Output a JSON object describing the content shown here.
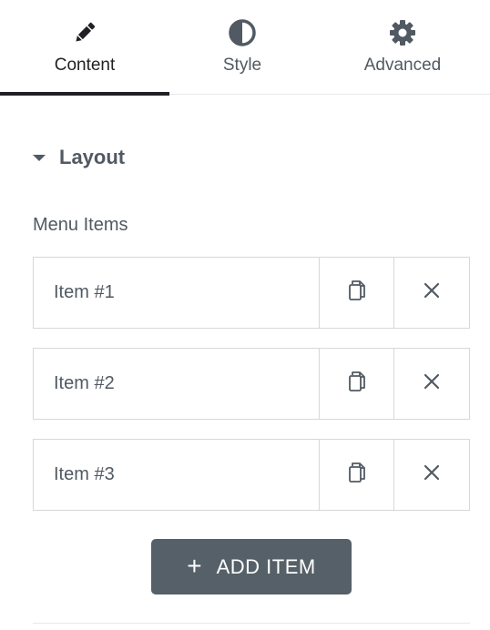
{
  "tabs": [
    {
      "label": "Content",
      "icon": "pencil-icon",
      "active": true
    },
    {
      "label": "Style",
      "icon": "contrast-icon",
      "active": false
    },
    {
      "label": "Advanced",
      "icon": "gear-icon",
      "active": false
    }
  ],
  "section": {
    "title": "Layout",
    "expanded": true
  },
  "menu_items": {
    "label": "Menu Items",
    "items": [
      {
        "title": "Item #1"
      },
      {
        "title": "Item #2"
      },
      {
        "title": "Item #3"
      }
    ]
  },
  "add_button": {
    "label": "ADD ITEM",
    "icon": "plus-icon"
  },
  "colors": {
    "text": "#515962",
    "active_text": "#1f2124",
    "border": "#d5d8dc",
    "button_bg": "#556068"
  }
}
